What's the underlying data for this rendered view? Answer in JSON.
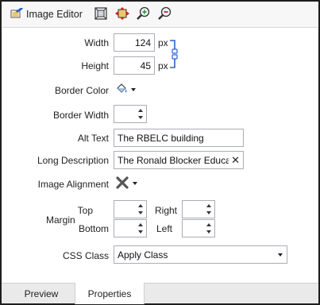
{
  "toolbar": {
    "title": "Image Editor",
    "icons": [
      "image-edit-icon",
      "fit-to-size-icon",
      "real-size-icon",
      "zoom-in-icon",
      "zoom-out-icon"
    ]
  },
  "size": {
    "width_label": "Width",
    "width_value": "124",
    "height_label": "Height",
    "height_value": "45",
    "unit": "px",
    "lock_icon": "aspect-lock-icon"
  },
  "border_color": {
    "label": "Border Color",
    "icon": "paint-bucket-icon"
  },
  "border_width": {
    "label": "Border Width",
    "value": ""
  },
  "alt_text": {
    "label": "Alt Text",
    "value": "The RBELC building"
  },
  "long_description": {
    "label": "Long Description",
    "value": "The Ronald Blocker Educa",
    "clear_glyph": "✕"
  },
  "image_alignment": {
    "label": "Image Alignment",
    "icon": "no-alignment-icon"
  },
  "margin": {
    "label": "Margin",
    "top_label": "Top",
    "right_label": "Right",
    "bottom_label": "Bottom",
    "left_label": "Left"
  },
  "css_class": {
    "label": "CSS Class",
    "value": "Apply Class"
  },
  "tabs": [
    {
      "label": "Preview",
      "active": false
    },
    {
      "label": "Properties",
      "active": true
    }
  ],
  "colors": {
    "accent": "#2b63c8",
    "window_border": "#1e1e1e"
  }
}
